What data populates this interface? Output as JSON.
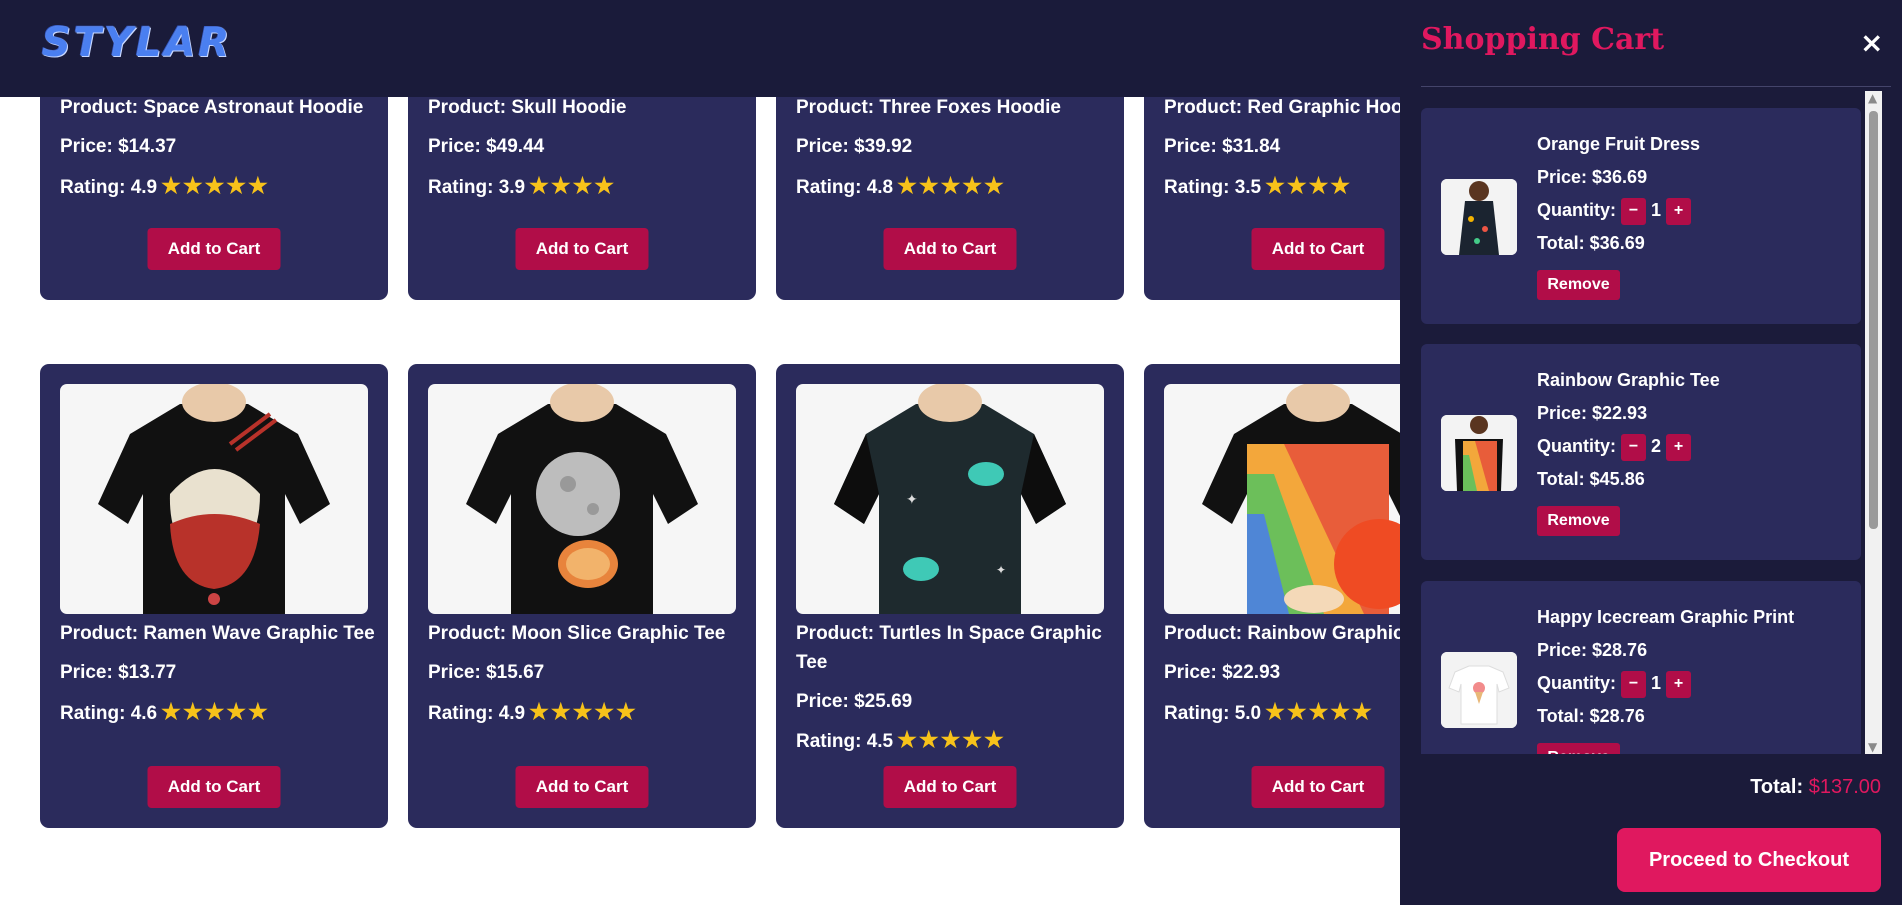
{
  "brand": {
    "logo_text": "STYLAR"
  },
  "products_top": [
    {
      "name": "Product: Space Astronaut Hoodie",
      "price": "Price: $14.37",
      "rating": "Rating: 4.9",
      "stars": "★★★★★",
      "add_label": "Add to Cart"
    },
    {
      "name": "Product: Skull Hoodie",
      "price": "Price: $49.44",
      "rating": "Rating: 3.9",
      "stars": "★★★★",
      "add_label": "Add to Cart"
    },
    {
      "name": "Product: Three Foxes Hoodie",
      "price": "Price: $39.92",
      "rating": "Rating: 4.8",
      "stars": "★★★★★",
      "add_label": "Add to Cart"
    },
    {
      "name": "Product: Red Graphic Hoodie",
      "price": "Price: $31.84",
      "rating": "Rating: 3.5",
      "stars": "★★★★",
      "add_label": "Add to Cart"
    }
  ],
  "products_bottom": [
    {
      "name": "Product: Ramen Wave Graphic Tee",
      "price": "Price: $13.77",
      "rating": "Rating: 4.6",
      "stars": "★★★★★",
      "add_label": "Add to Cart"
    },
    {
      "name": "Product: Moon Slice Graphic Tee",
      "price": "Price: $15.67",
      "rating": "Rating: 4.9",
      "stars": "★★★★★",
      "add_label": "Add to Cart"
    },
    {
      "name": "Product: Turtles In Space Graphic Tee",
      "price": "Price: $25.69",
      "rating": "Rating: 4.5",
      "stars": "★★★★★",
      "add_label": "Add to Cart"
    },
    {
      "name": "Product: Rainbow Graphic Tee",
      "price": "Price: $22.93",
      "rating": "Rating: 5.0",
      "stars": "★★★★★",
      "add_label": "Add to Cart"
    }
  ],
  "cart": {
    "title": "Shopping Cart",
    "close_icon": "×",
    "items": [
      {
        "name": "Orange Fruit Dress",
        "price": "Price: $36.69",
        "qty_label": "Quantity:",
        "qty": "1",
        "total": "Total: $36.69",
        "remove_label": "Remove"
      },
      {
        "name": "Rainbow Graphic Tee",
        "price": "Price: $22.93",
        "qty_label": "Quantity:",
        "qty": "2",
        "total": "Total: $45.86",
        "remove_label": "Remove"
      },
      {
        "name": "Happy Icecream Graphic Print",
        "price": "Price: $28.76",
        "qty_label": "Quantity:",
        "qty": "1",
        "total": "Total: $28.76",
        "remove_label": "Remove"
      }
    ],
    "total_label": "Total:",
    "total_amount": "$137.00",
    "checkout_label": "Proceed to Checkout",
    "minus": "−",
    "plus": "+"
  },
  "colors": {
    "accent": "#e0185f",
    "button": "#b10d48",
    "card": "#2b2b5c",
    "header": "#1a1b3a",
    "star": "#f7c21a"
  }
}
